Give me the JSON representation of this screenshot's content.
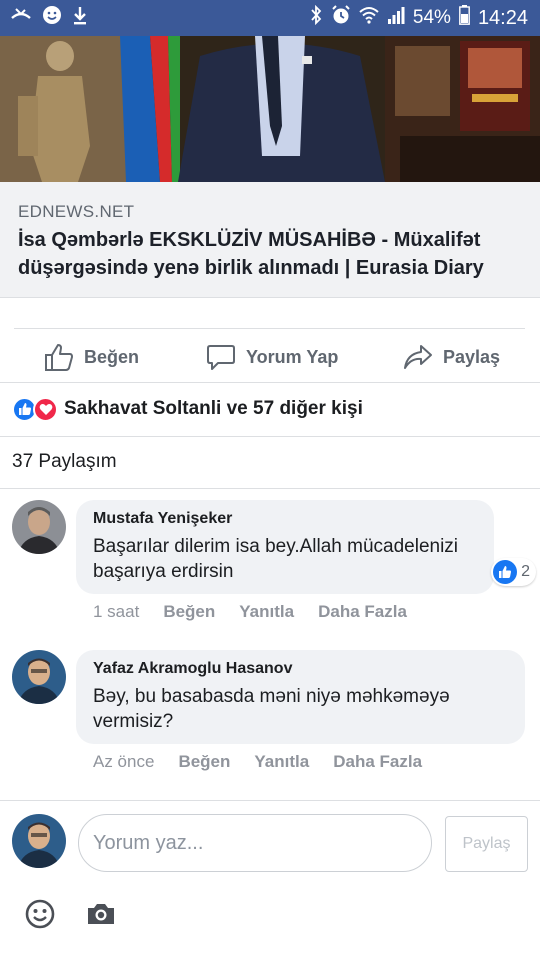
{
  "status_bar": {
    "battery": "54%",
    "time": "14:24"
  },
  "link_preview": {
    "domain": "EDNEWS.NET",
    "title": "İsa Qəmbərlə EKSKLÜZİV MÜSAHİBƏ - Müxalifət düşərgəsində yenə birlik alınmadı | Eurasia Diary"
  },
  "actions": {
    "like": "Beğen",
    "comment": "Yorum Yap",
    "share": "Paylaş"
  },
  "reactions": {
    "text": "Sakhavat Soltanli ve 57 diğer kişi"
  },
  "shares": {
    "text": "37 Paylaşım"
  },
  "comments": [
    {
      "name": "Mustafa Yenişeker",
      "text": "Başarılar dilerim isa bey.Allah mücadelenizi başarıya erdirsin",
      "time": "1 saat",
      "like": "Beğen",
      "reply": "Yanıtla",
      "more": "Daha Fazla",
      "reaction_count": "2"
    },
    {
      "name": "Yafaz Akramoglu Hasanov",
      "text": "Bəy, bu basabasda məni niyə məhkəməyə vermisiz?",
      "time": "Az önce",
      "like": "Beğen",
      "reply": "Yanıtla",
      "more": "Daha Fazla"
    }
  ],
  "composer": {
    "placeholder": "Yorum yaz...",
    "button": "Paylaş"
  },
  "colors": {
    "facebook_blue": "#3b5998",
    "like_blue": "#1877f2",
    "love_red": "#f0284a"
  }
}
